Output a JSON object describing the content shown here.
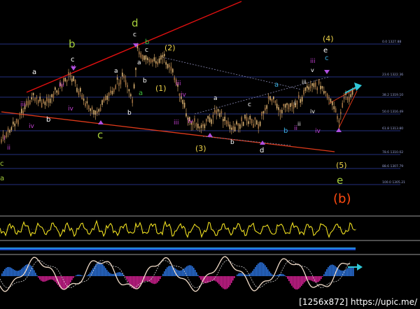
{
  "chart_data": {
    "type": "line",
    "title": "",
    "xlabel": "",
    "ylabel": "",
    "grid": true,
    "fib_levels": [
      {
        "label": "0.0 1327.88"
      },
      {
        "label": "23.6 1322.36"
      },
      {
        "label": "38.2 1319.10"
      },
      {
        "label": "50.0 1316.49"
      },
      {
        "label": "61.8 1313.80"
      },
      {
        "label": "78.6 1310.02"
      },
      {
        "label": "88.6 1307.79"
      },
      {
        "label": "100.0 1305.21"
      }
    ],
    "wave_labels": [
      {
        "text": "d",
        "color": "#a6cf3c"
      },
      {
        "text": "b",
        "color": "#a6cf3c"
      },
      {
        "text": "c",
        "color": "#a6cf3c"
      },
      {
        "text": "e",
        "color": "#a6cf3c"
      },
      {
        "text": "(4)",
        "color": "#f0d54a"
      },
      {
        "text": "(2)",
        "color": "#f0d54a"
      },
      {
        "text": "(1)",
        "color": "#f0d54a"
      },
      {
        "text": "(3)",
        "color": "#f0d54a"
      },
      {
        "text": "(5)",
        "color": "#f0d54a"
      },
      {
        "text": "(b)",
        "color": "#ff4a10"
      },
      {
        "text": "a",
        "color": "#ffffff"
      },
      {
        "text": "b",
        "color": "#ffffff"
      },
      {
        "text": "c",
        "color": "#ffffff"
      },
      {
        "text": "d",
        "color": "#ffffff"
      },
      {
        "text": "e",
        "color": "#ffffff"
      },
      {
        "text": "c",
        "color": "#3ab0e0"
      },
      {
        "text": "a",
        "color": "#3ab0e0"
      },
      {
        "text": "b",
        "color": "#3ab0e0"
      },
      {
        "text": "iii",
        "color": "#c040d0"
      },
      {
        "text": "iv",
        "color": "#c040d0"
      },
      {
        "text": "v",
        "color": "#c040d0"
      },
      {
        "text": "ii",
        "color": "#c040d0"
      },
      {
        "text": "i",
        "color": "#c040d0"
      },
      {
        "text": "a",
        "color": "#3fbf3f"
      },
      {
        "text": "b",
        "color": "#3fbf3f"
      }
    ]
  },
  "watermark": "[1256x872] https://upic.me/"
}
